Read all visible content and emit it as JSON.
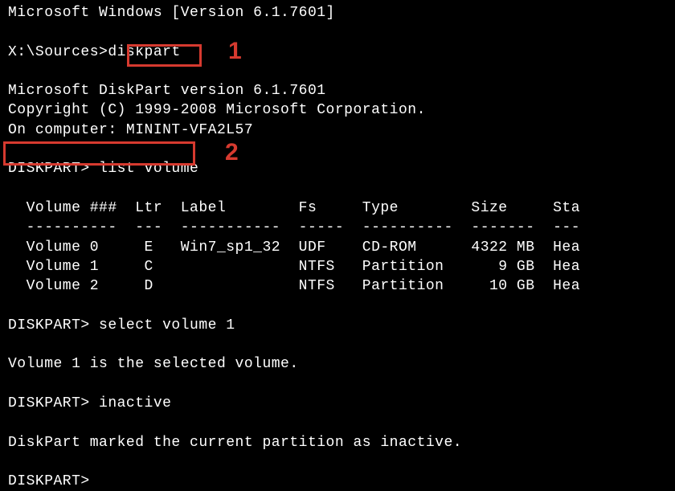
{
  "header_version": "Microsoft Windows [Version 6.1.7601]",
  "prompt1_path": "X:\\Sources>",
  "prompt1_cmd": "diskpart",
  "diskpart_version": "Microsoft DiskPart version 6.1.7601",
  "copyright": "Copyright (C) 1999-2008 Microsoft Corporation.",
  "on_computer": "On computer: MININT-VFA2L57",
  "prompt2_label": "DISKPART>",
  "prompt2_cmd": " list volume",
  "table_header": "  Volume ###  Ltr  Label        Fs     Type        Size     Sta",
  "table_divider": "  ----------  ---  -----------  -----  ----------  -------  ---",
  "table_rows": [
    "  Volume 0     E   Win7_sp1_32  UDF    CD-ROM      4322 MB  Hea",
    "  Volume 1     C                NTFS   Partition      9 GB  Hea",
    "  Volume 2     D                NTFS   Partition     10 GB  Hea"
  ],
  "prompt3_cmd": " select volume 1",
  "selected_msg": "Volume 1 is the selected volume.",
  "prompt4_cmd": " inactive",
  "inactive_msg": "DiskPart marked the current partition as inactive.",
  "prompt5_label": "DISKPART>",
  "callouts": {
    "one": "1",
    "two": "2"
  }
}
